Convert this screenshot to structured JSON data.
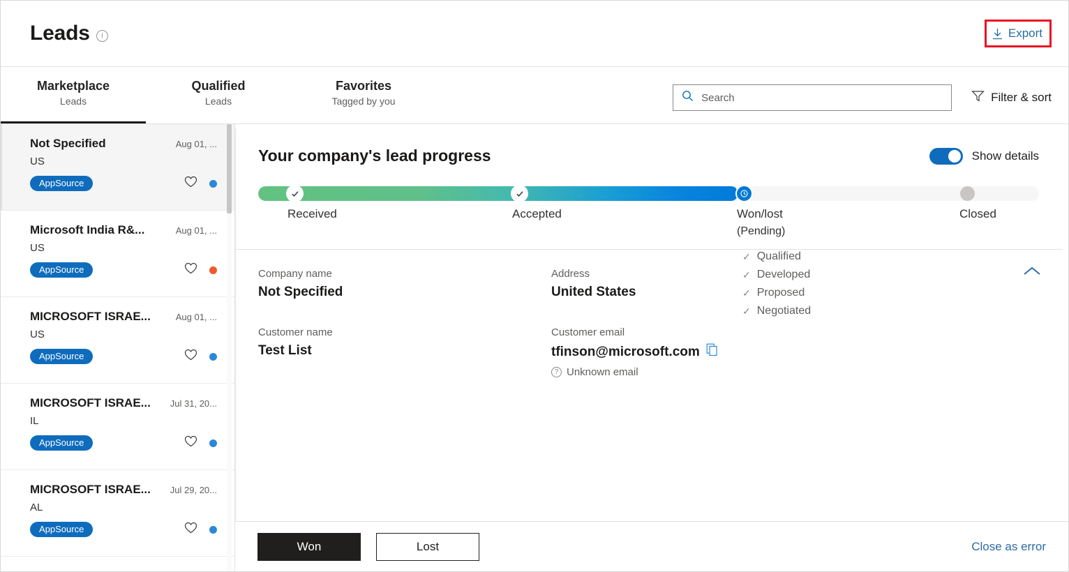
{
  "header": {
    "title": "Leads",
    "info_icon": "info-icon",
    "export_label": "Export",
    "export_icon": "download-icon",
    "highlight_color": "#e81123",
    "link_color": "#2b6ca3"
  },
  "toolbar": {
    "tabs": [
      {
        "label": "Marketplace",
        "sub": "Leads",
        "active": true
      },
      {
        "label": "Qualified",
        "sub": "Leads",
        "active": false
      },
      {
        "label": "Favorites",
        "sub": "Tagged by you",
        "active": false
      }
    ],
    "search": {
      "value": "",
      "placeholder": "Search",
      "icon": "search-icon"
    },
    "filter_label": "Filter & sort",
    "filter_icon": "funnel-icon"
  },
  "lead_list": {
    "items": [
      {
        "name": "Not Specified",
        "date": "Aug 01, ...",
        "country": "US",
        "badge": "AppSource",
        "dot_color": "#2b88d8",
        "selected": true
      },
      {
        "name": "Microsoft India R&...",
        "date": "Aug 01, ...",
        "country": "US",
        "badge": "AppSource",
        "dot_color": "#f2582b",
        "selected": false
      },
      {
        "name": "MICROSOFT ISRAE...",
        "date": "Aug 01, ...",
        "country": "US",
        "badge": "AppSource",
        "dot_color": "#2b88d8",
        "selected": false
      },
      {
        "name": "MICROSOFT ISRAE...",
        "date": "Jul 31, 20...",
        "country": "IL",
        "badge": "AppSource",
        "dot_color": "#2b88d8",
        "selected": false
      },
      {
        "name": "MICROSOFT ISRAE...",
        "date": "Jul 29, 20...",
        "country": "AL",
        "badge": "AppSource",
        "dot_color": "#2b88d8",
        "selected": false
      }
    ]
  },
  "progress": {
    "title": "Your company's lead progress",
    "toggle_label": "Show details",
    "toggle_on": true,
    "fill_start_color": "#62c281",
    "fill_end_color": "#007ad9",
    "steps": [
      {
        "label": "Received",
        "state": "done"
      },
      {
        "label": "Accepted",
        "state": "done"
      },
      {
        "label": "Won/lost",
        "sub": "(Pending)",
        "state": "current"
      },
      {
        "label": "Closed",
        "state": "pending"
      }
    ],
    "checklist": [
      "Qualified",
      "Developed",
      "Proposed",
      "Negotiated"
    ]
  },
  "details": {
    "collapse_icon": "chevron-up-icon",
    "fields": [
      {
        "label": "Company name",
        "value": "Not Specified"
      },
      {
        "label": "Address",
        "value": "United States"
      },
      {
        "label": "Customer name",
        "value": "Test List"
      },
      {
        "label": "Customer email",
        "value": "tfinson@microsoft.com",
        "copyable": true,
        "note": "Unknown email"
      }
    ]
  },
  "actions": {
    "won_label": "Won",
    "lost_label": "Lost",
    "close_error_label": "Close as error"
  }
}
